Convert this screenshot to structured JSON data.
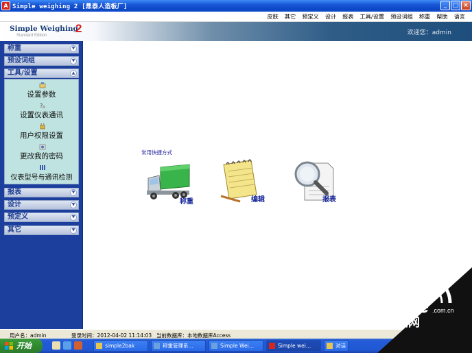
{
  "window": {
    "title": "Simple weighing 2 [鼎泰人造板厂]",
    "icon_text": "A",
    "min": "_",
    "max": "□",
    "close": "×"
  },
  "menu": [
    "皮肤",
    "其它",
    "预定义",
    "设计",
    "报表",
    "工具/设置",
    "预设词组",
    "称重",
    "帮助",
    "语言"
  ],
  "banner": {
    "logo": "Simple Weighing",
    "logo_num": "2",
    "logo_sub": "Standard Edition",
    "welcome": "欢迎您：admin"
  },
  "sidebar": {
    "sections": [
      {
        "label": "称重",
        "chevron": "▼"
      },
      {
        "label": "预设词组",
        "chevron": "▼"
      },
      {
        "label": "工具/设置",
        "chevron": "▲"
      },
      {
        "label": "报表",
        "chevron": "▼"
      },
      {
        "label": "设计",
        "chevron": "▼"
      },
      {
        "label": "预定义",
        "chevron": "▼"
      },
      {
        "label": "其它",
        "chevron": "▼"
      }
    ],
    "tool_items": [
      {
        "label": "设置参数",
        "icon": "settings-icon"
      },
      {
        "label": "设置仪表通讯",
        "icon": "meter-comm-icon"
      },
      {
        "label": "用户权限设置",
        "icon": "user-permission-icon"
      },
      {
        "label": "更改我的密码",
        "icon": "password-icon"
      },
      {
        "label": "仪表型号与通讯检测",
        "icon": "meter-model-icon"
      }
    ]
  },
  "quick": {
    "title": "常用快捷方式",
    "items": [
      {
        "label": "称重",
        "icon": "truck-icon"
      },
      {
        "label": "编辑",
        "icon": "notepad-icon"
      },
      {
        "label": "报表",
        "icon": "magnifier-report-icon"
      }
    ]
  },
  "status": {
    "user": "用户名：admin",
    "login": "登录时间：2012-04-02 11:14:03",
    "db": "当前数据库：本地数据库Access"
  },
  "taskbar": {
    "start": "开始",
    "tasks": [
      "simple2bak",
      "称重管理系…",
      "Simple Wei…",
      "Simple wei…",
      "对话"
    ]
  },
  "watermark": {
    "brand": "PConline",
    "domain": ".com.cn",
    "cn": "太平洋电脑网"
  }
}
